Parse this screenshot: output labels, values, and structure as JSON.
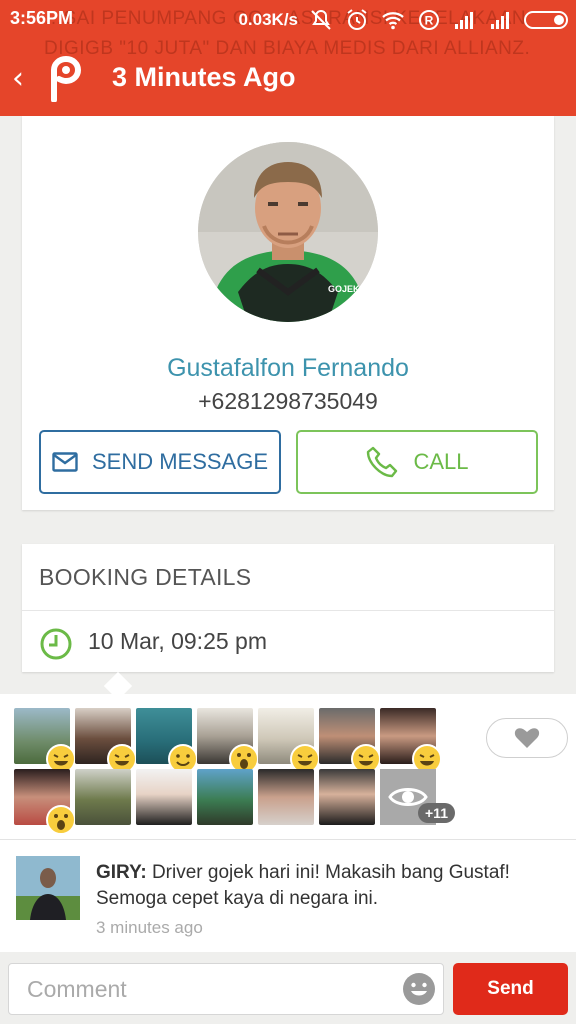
{
  "status_bar": {
    "time": "3:56PM",
    "net_speed": "0.03K/s"
  },
  "background_text": "…SAI PENUMPANG GO… ASURANSI KECELAKAAN DIGIGB \"10 JUTA\" DAN BIAYA MEDIS DARI ALLIANZ.",
  "header": {
    "title": "3 Minutes Ago",
    "accent_color": "#e5452a"
  },
  "driver": {
    "name": "Gustafalfon Fernando",
    "phone": "+6281298735049",
    "send_message_label": "SEND MESSAGE",
    "call_label": "CALL"
  },
  "booking": {
    "title": "BOOKING DETAILS",
    "datetime": "10 Mar, 09:25 pm"
  },
  "reactions": {
    "row1_emojis": [
      "laugh",
      "laugh",
      "smile",
      "wow",
      "laugh",
      "laugh",
      "laugh"
    ],
    "row2_emojis": [
      "wow"
    ],
    "more_count": "+11"
  },
  "comment": {
    "author": "GIRY:",
    "text": " Driver gojek hari ini! Makasih bang Gustaf! Semoga cepet kaya di negara ini.",
    "time": "3 minutes ago"
  },
  "composer": {
    "placeholder": "Comment",
    "send_label": "Send"
  }
}
